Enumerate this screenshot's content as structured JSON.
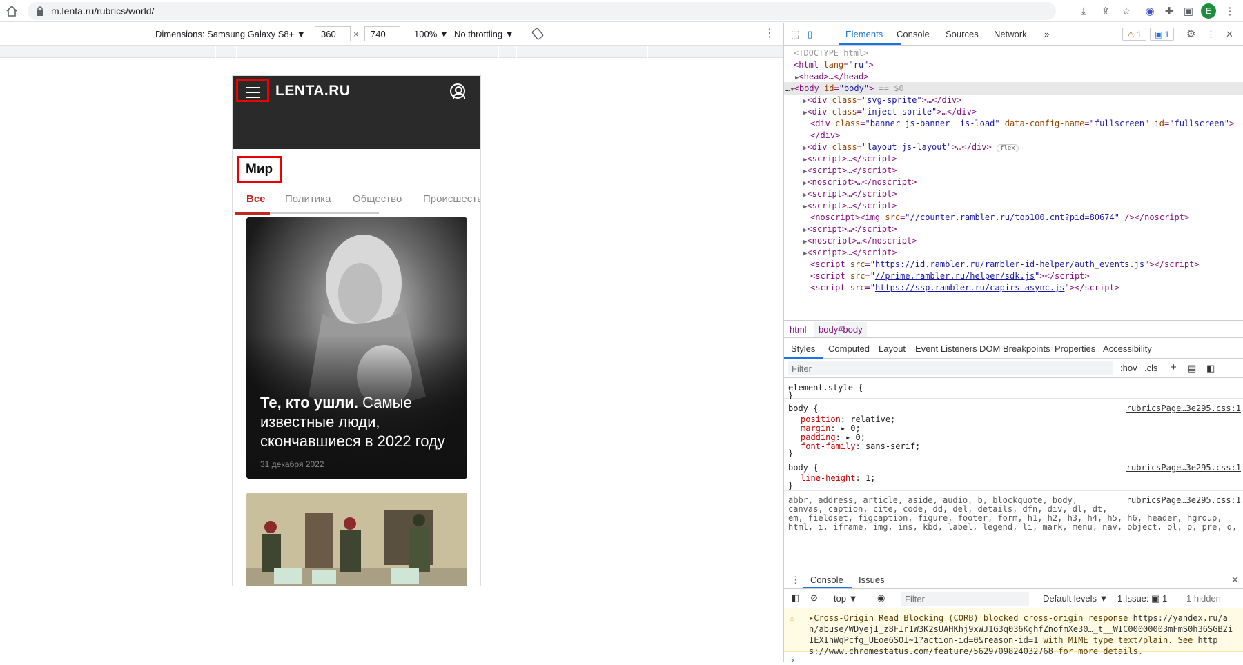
{
  "browser": {
    "url": "m.lenta.ru/rubrics/world/",
    "profile_letter": "E"
  },
  "device_toolbar": {
    "dimensions_label": "Dimensions: Samsung Galaxy S8+ ▼",
    "width": "360",
    "times": "×",
    "height": "740",
    "zoom": "100% ▼",
    "throttling": "No throttling ▼"
  },
  "page": {
    "logo": "LENTA.RU",
    "rubric_title": "Мир",
    "tabs": [
      "Все",
      "Политика",
      "Общество",
      "Происшествия"
    ],
    "active_tab": "Все",
    "card1": {
      "title_bold": "Те, кто ушли.",
      "title_rest": " Самые известные люди, скончавшиеся в 2022 году",
      "date": "31 декабря 2022"
    }
  },
  "devtools": {
    "tabs": [
      "Elements",
      "Console",
      "Sources",
      "Network",
      "»"
    ],
    "active_tab": "Elements",
    "warnings_badge": "⚠ 1",
    "messages_badge": "▣ 1",
    "breadcrumbs": {
      "html": "html",
      "body": "body#body"
    },
    "styles_tabs": [
      "Styles",
      "Computed",
      "Layout",
      "Event Listeners",
      "DOM Breakpoints",
      "Properties",
      "Accessibility"
    ],
    "filter_placeholder": "Filter",
    "hov": ":hov",
    "cls": ".cls",
    "element_style": "element.style {",
    "closing_brace": "}",
    "rule1": {
      "selector": "body {",
      "source": "rubricsPage…3e295.css:1",
      "props": [
        [
          "position",
          "relative;"
        ],
        [
          "margin",
          "▸ 0;"
        ],
        [
          "padding",
          "▸ 0;"
        ],
        [
          "font-family",
          "sans-serif;"
        ]
      ]
    },
    "rule2": {
      "selector": "body {",
      "source": "rubricsPage…3e295.css:1",
      "props": [
        [
          "line-height",
          "1;"
        ]
      ]
    },
    "rule3": {
      "source": "rubricsPage…3e295.css:1",
      "lines": [
        "abbr, address, article, aside, audio, b, blockquote, body,",
        "canvas, caption, cite, code, dd, del, details, dfn, div, dl, dt,",
        "em, fieldset, figcaption, figure, footer, form, h1, h2, h3, h4, h5, h6, header, hgroup,",
        "html, i, iframe, img, ins, kbd, label, legend, li, mark, menu, nav, object, ol, p, pre, q,"
      ]
    },
    "drawer_tabs": [
      "Console",
      "Issues"
    ],
    "console_context": "top ▼",
    "console_filter": "Filter",
    "default_levels": "Default levels ▼",
    "issues_badge": "1 Issue: ▣ 1",
    "hidden": "1 hidden",
    "warning": {
      "prefix": "▸Cross-Origin Read Blocking (CORB) blocked cross-origin response ",
      "link1": "https://yandex.ru/an/abuse/WDyejI_z8FIr1W3K2sUAHKhj9xWJ1G3q036KghfZnofmXe30…_t__WIC00000003mFmS0h36SGB2iIEXIhWqPcfg_UEoe6SOI~1?action-id=0&reason-id=1",
      "mid": " with MIME type text/plain. See ",
      "link2": "https://www.chromestatus.com/feature/5629709824032768",
      "suffix": " for more details."
    },
    "prompt": "›"
  }
}
